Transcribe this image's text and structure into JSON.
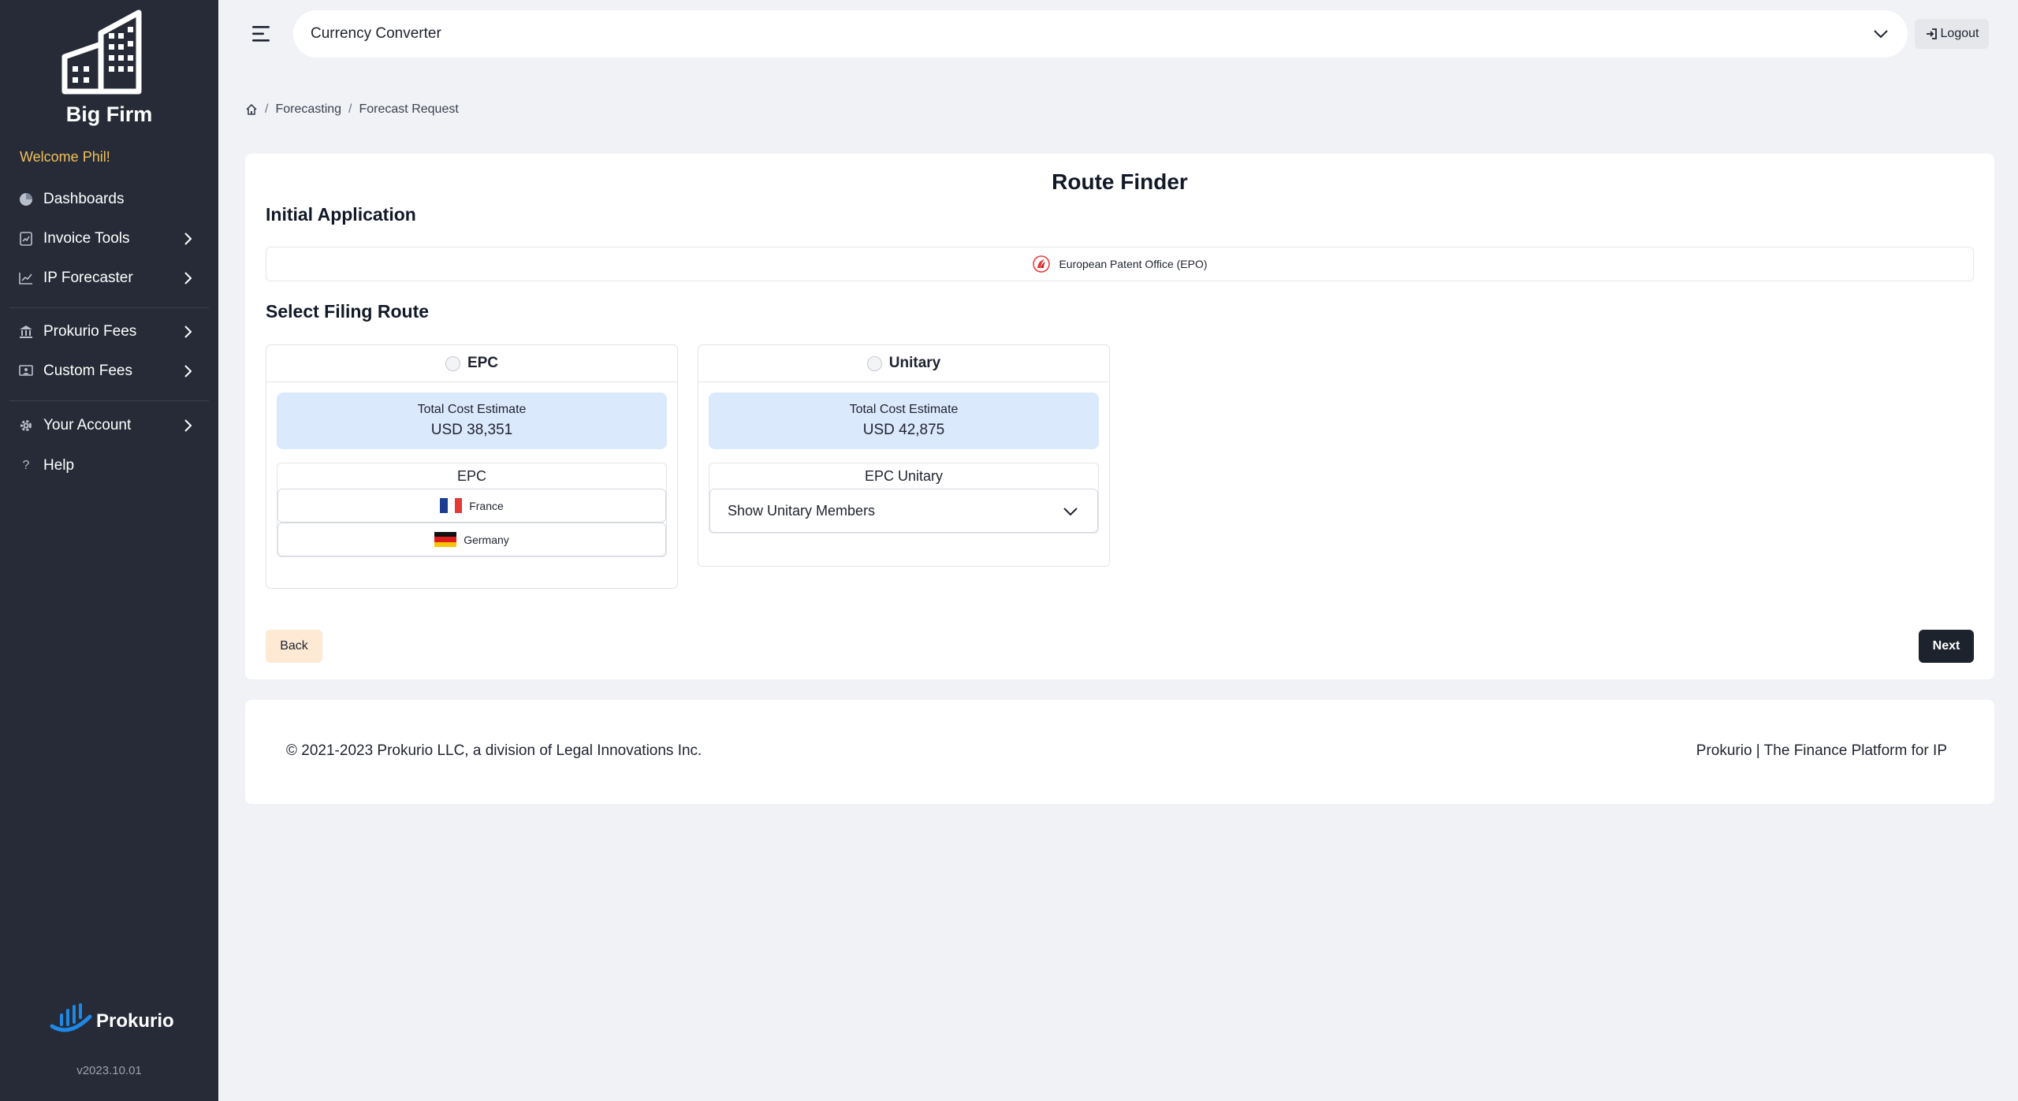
{
  "sidebar": {
    "brand": "Big Firm",
    "welcome": "Welcome Phil!",
    "items": [
      {
        "label": "Dashboards"
      },
      {
        "label": "Invoice Tools"
      },
      {
        "label": "IP Forecaster"
      },
      {
        "label": "Prokurio Fees"
      },
      {
        "label": "Custom Fees"
      },
      {
        "label": "Your Account"
      },
      {
        "label": "Help"
      }
    ],
    "footer": {
      "name": "Prokurio",
      "version": "v2023.10.01"
    }
  },
  "topbar": {
    "currency_label": "Currency Converter",
    "logout_label": "Logout"
  },
  "breadcrumb": {
    "items": [
      "Forecasting",
      "Forecast Request"
    ]
  },
  "main": {
    "title": "Route Finder",
    "initial_heading": "Initial Application",
    "office": "European Patent Office (EPO)",
    "route_heading": "Select Filing Route",
    "routes": [
      {
        "label": "EPC",
        "estimate_label": "Total Cost Estimate",
        "estimate_value": "USD 38,351",
        "group_title": "EPC",
        "countries": [
          "France",
          "Germany"
        ]
      },
      {
        "label": "Unitary",
        "estimate_label": "Total Cost Estimate",
        "estimate_value": "USD 42,875",
        "group_title": "EPC Unitary",
        "select_label": "Show Unitary Members"
      }
    ],
    "back_label": "Back",
    "next_label": "Next"
  },
  "footer": {
    "copyright": "© 2021-2023 Prokurio LLC, a division of Legal Innovations Inc.",
    "tagline": "Prokurio | The Finance Platform for IP"
  },
  "colors": {
    "sidebar_bg": "#262b37",
    "welcome": "#f3c05a",
    "estimate_bg": "#dbe9fc",
    "next_bg": "#1d232d",
    "back_bg": "#fde9d4",
    "accent_blue": "#1e88e5"
  }
}
